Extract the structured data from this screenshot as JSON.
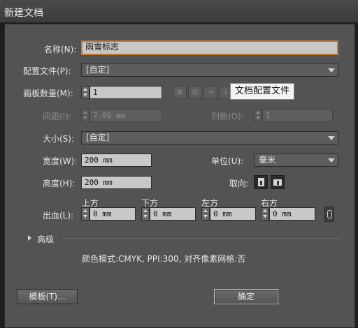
{
  "window": {
    "title": "新建文档"
  },
  "name": {
    "label": "名称(N):",
    "value": "雨雪标志"
  },
  "profile": {
    "label": "配置文件(P):",
    "value": "[自定]"
  },
  "artboards": {
    "count_label": "画板数量(M):",
    "count_value": "1",
    "layout_icons": [
      "grid-by-row-icon",
      "grid-by-column-icon",
      "arrange-by-row-icon",
      "arrange-by-column-icon"
    ],
    "tooltip": "文档配置文件",
    "spacing_label": "间距(I):",
    "spacing_value": "7.06 mm",
    "columns_label": "列数(O):",
    "columns_value": "1"
  },
  "size": {
    "label": "大小(S):",
    "value": "[自定]"
  },
  "width": {
    "label": "宽度(W):",
    "value": "200 mm"
  },
  "units": {
    "label": "单位(U):",
    "value": "毫米"
  },
  "height": {
    "label": "高度(H):",
    "value": "200 mm"
  },
  "orientation": {
    "label": "取向:"
  },
  "bleed": {
    "label": "出血(L):",
    "top_label": "上方",
    "top_value": "0 mm",
    "bottom_label": "下方",
    "bottom_value": "0 mm",
    "left_label": "左方",
    "left_value": "0 mm",
    "right_label": "右方",
    "right_value": "0 mm"
  },
  "advanced": {
    "label": "高级"
  },
  "summary": "颜色模式:CMYK, PPI:300, 对齐像素网格:否",
  "buttons": {
    "templates": "模板(T)...",
    "ok": "确定"
  }
}
